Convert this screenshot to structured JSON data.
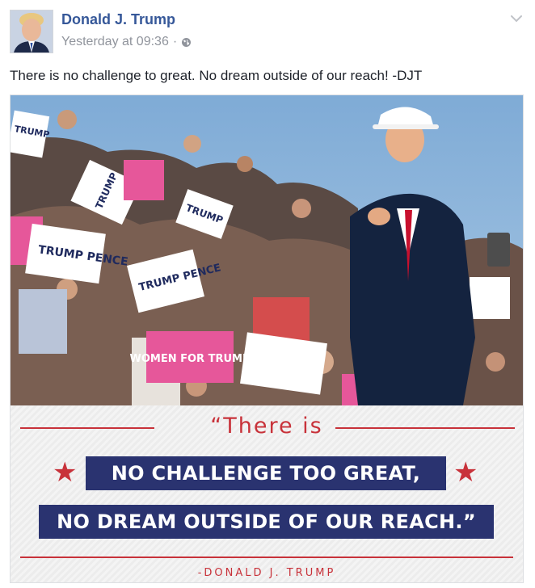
{
  "post": {
    "author_name": "Donald J. Trump",
    "timestamp": "Yesterday at 09:36",
    "separator": "·",
    "privacy_icon": "globe-icon",
    "menu_icon": "chevron-down-icon",
    "text": "There is no challenge to great. No dream outside of our reach! -DJT"
  },
  "image": {
    "signs": {
      "sign_1": "TRUMP",
      "sign_2": "TRUMP",
      "sign_3": "TRUMP",
      "sign_4": "WOMEN FOR TRUMP",
      "sign_5": "TRUMP PENCE",
      "sign_6": "TRUMP PENCE"
    },
    "quote": {
      "line1": "“There is",
      "line2": "NO CHALLENGE TOO GREAT,",
      "line3": "NO DREAM OUTSIDE OF OUR REACH.”",
      "attribution": "-DONALD J. TRUMP"
    },
    "colors": {
      "sky": "#8fb6dc",
      "banner": "#2a3370",
      "accent_red": "#c8323a",
      "link_blue": "#365899"
    }
  }
}
